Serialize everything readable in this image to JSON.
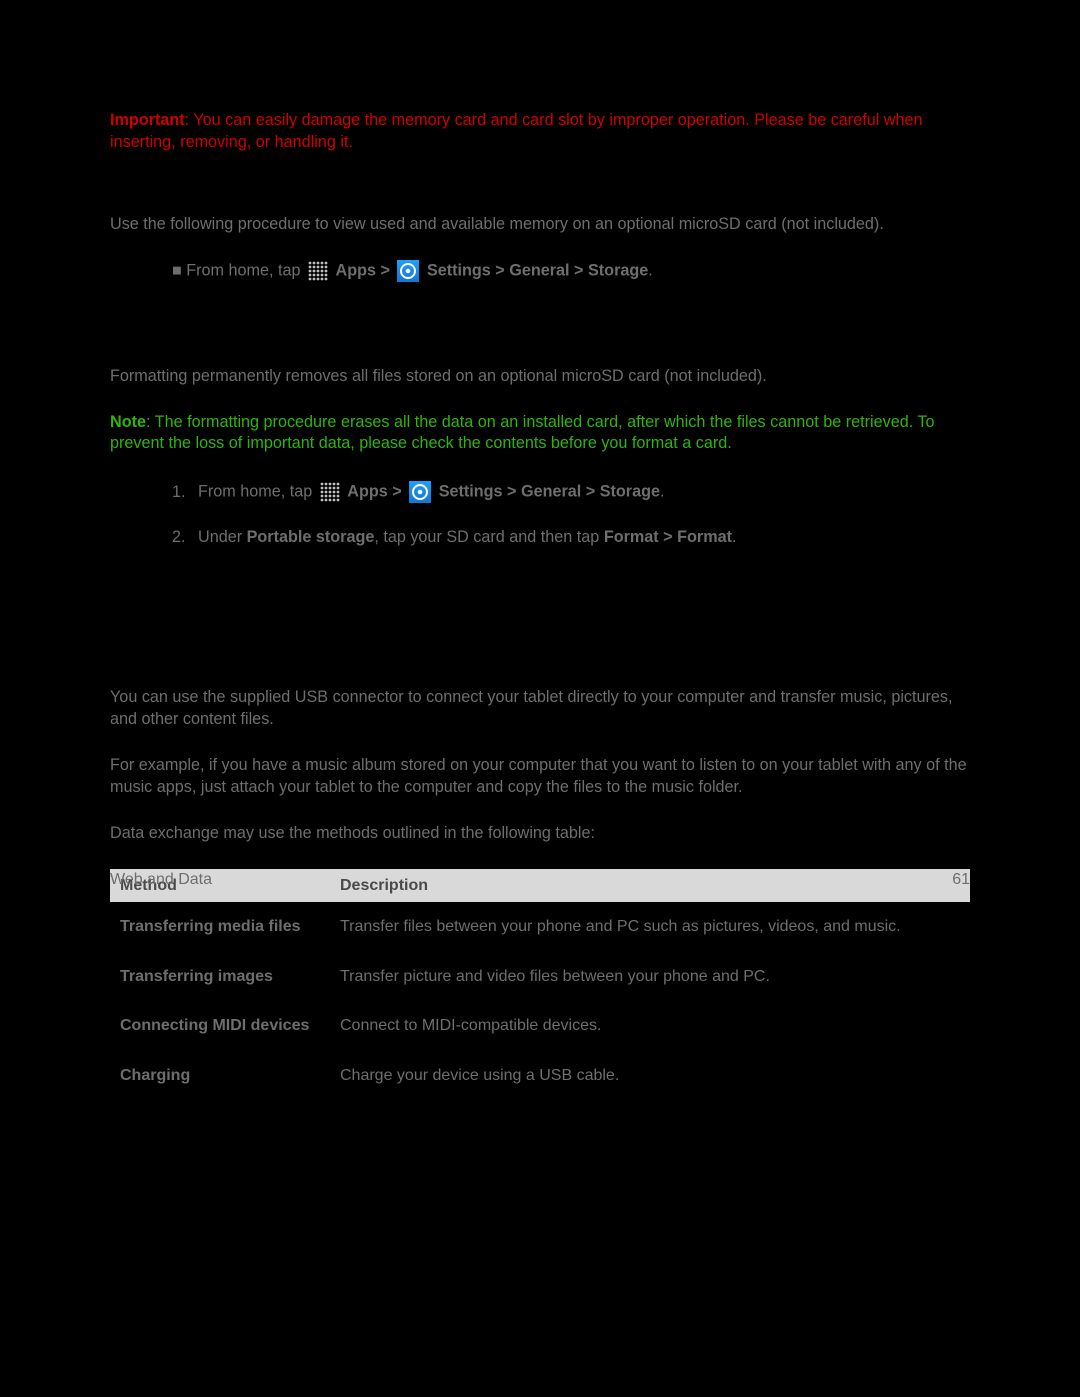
{
  "important": {
    "label": "Important",
    "text": ": You can easily damage the memory card and card slot by improper operation. Please be careful when inserting, removing, or handling it."
  },
  "view_mem": {
    "para": "Use the following procedure to view used and available memory on an optional microSD card (not included).",
    "step_prefix": "■   From home, tap ",
    "breadcrumb_apps": "Apps > ",
    "breadcrumb_rest": "Settings > General > Storage",
    "period": "."
  },
  "format": {
    "para": "Formatting permanently removes all files stored on an optional microSD card (not included).",
    "note_label": "Note",
    "note_text": ": The formatting procedure erases all the data on an installed card, after which the files cannot be retrieved. To prevent the loss of important data, please check the contents before you format a card.",
    "steps": [
      {
        "num": "1.",
        "prefix": "From home, tap ",
        "bc_apps": "Apps > ",
        "bc_rest": "Settings > General > Storage",
        "suffix": "."
      },
      {
        "num": "2.",
        "prefix": "Under ",
        "bold1": "Portable storage",
        "mid": ", tap your SD card and then tap ",
        "bold2": "Format > Format",
        "suffix": "."
      }
    ]
  },
  "transfer": {
    "p1": "You can use the supplied USB connector to connect your tablet directly to your computer and transfer music, pictures, and other content files.",
    "p2": "For example, if you have a music album stored on your computer that you want to listen to on your tablet with any of the music apps, just attach your tablet to the computer and copy the files to the music folder.",
    "p3": "Data exchange may use the methods outlined in the following table:"
  },
  "table": {
    "headers": {
      "method": "Method",
      "description": "Description"
    },
    "rows": [
      {
        "method": "Transferring media files",
        "desc": "Transfer files between your phone and PC such as pictures, videos, and music."
      },
      {
        "method": "Transferring images",
        "desc": "Transfer picture and video files between your phone and PC."
      },
      {
        "method": "Connecting MIDI devices",
        "desc": "Connect to MIDI-compatible devices."
      },
      {
        "method": "Charging",
        "desc": "Charge your device using a USB cable."
      }
    ]
  },
  "footer": {
    "section": "Web and Data",
    "page": "61"
  }
}
